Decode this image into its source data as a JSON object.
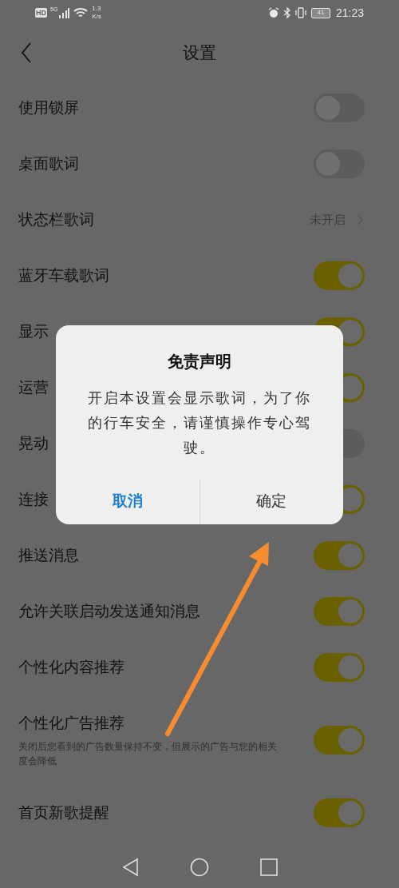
{
  "status_bar": {
    "hd_badge": "HD",
    "network": "5G",
    "speed": "1.3",
    "speed_unit": "K/s",
    "battery": "41",
    "time": "21:23"
  },
  "header": {
    "title": "设置"
  },
  "rows": [
    {
      "kind": "toggle",
      "label": "使用锁屏",
      "on": false
    },
    {
      "kind": "toggle",
      "label": "桌面歌词",
      "on": false
    },
    {
      "kind": "value",
      "label": "状态栏歌词",
      "value": "未开启"
    },
    {
      "kind": "toggle",
      "label": "蓝牙车载歌词",
      "on": true
    },
    {
      "kind": "toggle",
      "label": "显示",
      "on": true
    },
    {
      "kind": "toggle",
      "label": "运营",
      "on": true
    },
    {
      "kind": "toggle",
      "label": "晃动",
      "on": false
    },
    {
      "kind": "toggle",
      "label": "连接",
      "on": true
    },
    {
      "kind": "toggle",
      "label": "推送消息",
      "on": true
    },
    {
      "kind": "toggle",
      "label": "允许关联启动发送通知消息",
      "on": true
    },
    {
      "kind": "toggle",
      "label": "个性化内容推荐",
      "on": true
    },
    {
      "kind": "toggle",
      "label": "个性化广告推荐",
      "on": true,
      "description": "关闭后您看到的广告数量保持不变，但展示的广告与您的相关度会降低"
    },
    {
      "kind": "toggle",
      "label": "首页新歌提醒",
      "on": true
    }
  ],
  "dialog": {
    "title": "免责声明",
    "message": "开启本设置会显示歌词，为了你的行车安全，请谨慎操作专心驾驶。",
    "buttons": [
      {
        "label": "取消",
        "kind": "primary"
      },
      {
        "label": "确定",
        "kind": "normal"
      }
    ]
  }
}
